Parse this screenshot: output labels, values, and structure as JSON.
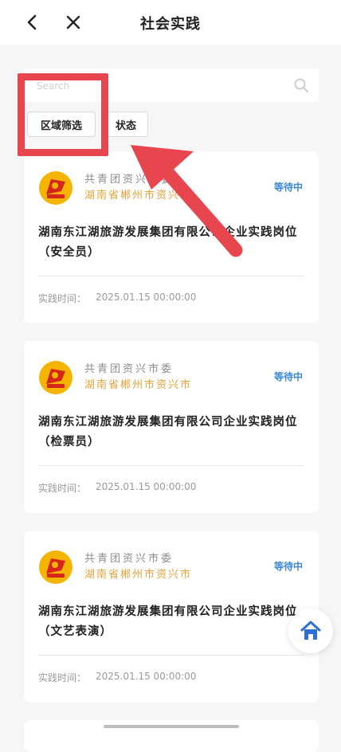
{
  "header": {
    "title": "社会实践"
  },
  "icons": {
    "back": "chevron-left-icon",
    "close": "close-icon",
    "search": "search-icon",
    "home": "home-icon"
  },
  "search": {
    "placeholder": "Search"
  },
  "filters": [
    {
      "label": "区域筛选"
    },
    {
      "label": "状态"
    }
  ],
  "cards": [
    {
      "org": "共青团资兴市委",
      "location": "湖南省郴州市资兴市",
      "status": "等待中",
      "title": "湖南东江湖旅游发展集团有限公司企业实践岗位（安全员）",
      "time_label": "实践时间：",
      "time_value": "2025.01.15 00:00:00"
    },
    {
      "org": "共青团资兴市委",
      "location": "湖南省郴州市资兴市",
      "status": "等待中",
      "title": "湖南东江湖旅游发展集团有限公司企业实践岗位（检票员）",
      "time_label": "实践时间：",
      "time_value": "2025.01.15 00:00:00"
    },
    {
      "org": "共青团资兴市委",
      "location": "湖南省郴州市资兴市",
      "status": "等待中",
      "title": "湖南东江湖旅游发展集团有限公司企业实践岗位（文艺表演）",
      "time_label": "实践时间：",
      "time_value": "2025.01.15 00:00:00"
    }
  ],
  "colors": {
    "status": "#3a88d6",
    "location": "#e3a23a",
    "annotation": "#e8464e",
    "home": "#2f6fd6"
  }
}
